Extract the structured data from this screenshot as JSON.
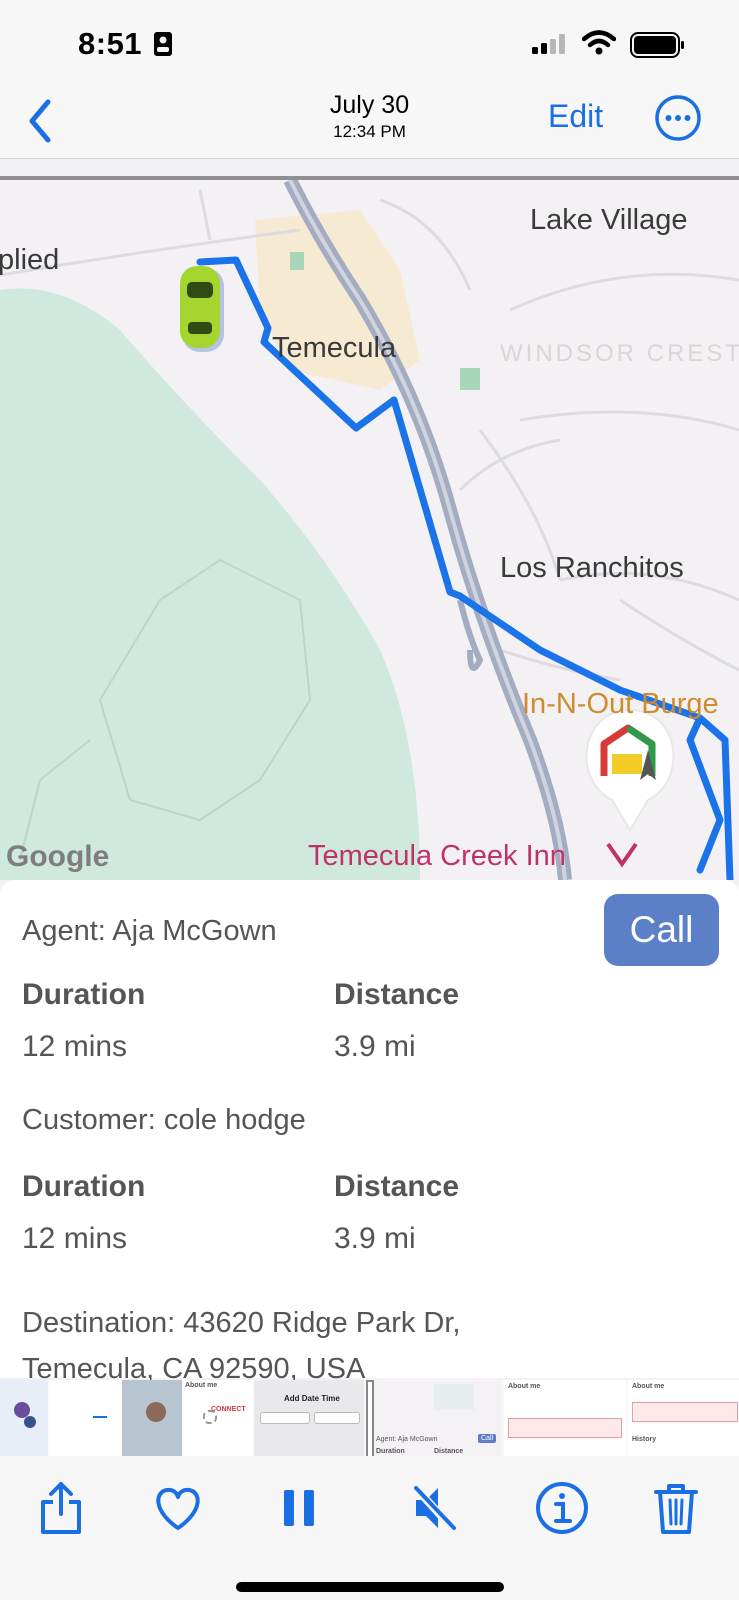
{
  "status_bar": {
    "time": "8:51"
  },
  "nav": {
    "date": "July 30",
    "time": "12:34 PM",
    "edit_label": "Edit"
  },
  "map": {
    "labels": {
      "lake_village": "Lake Village",
      "plied": "plied",
      "temecula": "Temecula",
      "windsor": "WINDSOR CREST",
      "los_ranchitos": "Los Ranchitos",
      "in_n_out": "In-N-Out Burge",
      "creek_inn": "Temecula Creek Inn",
      "google": "Google"
    },
    "route_color": "#1a73e8",
    "car_color": "#a4d62f"
  },
  "agent": {
    "label": "Agent: Aja McGown",
    "call_label": "Call",
    "duration_label": "Duration",
    "duration_value": "12 mins",
    "distance_label": "Distance",
    "distance_value": "3.9 mi"
  },
  "customer": {
    "label": "Customer: cole hodge",
    "duration_label": "Duration",
    "duration_value": "12 mins",
    "distance_label": "Distance",
    "distance_value": "3.9 mi"
  },
  "destination": {
    "line1": "Destination: 43620 Ridge Park Dr,",
    "line2": "Temecula, CA 92590, USA"
  },
  "thumbnails": {
    "about_me": "About me",
    "add_date_time": "Add Date Time",
    "agent_label": "Agent: Aja McGown",
    "call": "Call",
    "duration": "Duration",
    "distance": "Distance",
    "history": "History",
    "connect": "CONNECT"
  },
  "toolbar": {
    "share": "share-icon",
    "favorite": "heart-icon",
    "pause": "pause-icon",
    "mute": "speaker-muted-icon",
    "info": "info-icon",
    "delete": "trash-icon",
    "accent": "#1b6fe4"
  }
}
